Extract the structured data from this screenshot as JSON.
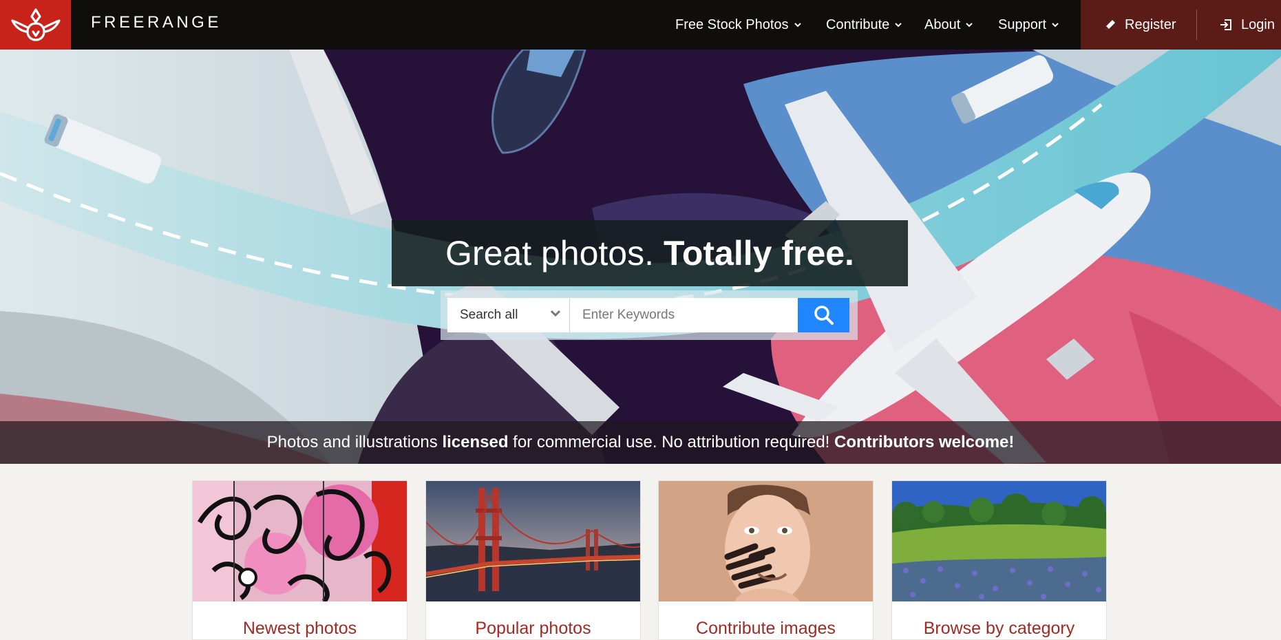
{
  "brand": {
    "name": "FREERANGE",
    "logo_icon": "lotus-logo-icon",
    "logo_color": "#c8231b"
  },
  "nav": {
    "items": [
      {
        "label": "Free Stock Photos",
        "icon": "chevron-down-icon"
      },
      {
        "label": "Contribute",
        "icon": "chevron-down-icon"
      },
      {
        "label": "About",
        "icon": "chevron-down-icon"
      },
      {
        "label": "Support",
        "icon": "chevron-down-icon"
      }
    ],
    "register": {
      "label": "Register",
      "icon": "pencil-icon"
    },
    "login": {
      "label": "Login",
      "icon": "login-icon"
    }
  },
  "hero": {
    "headline_regular": "Great photos.",
    "headline_bold": "Totally free.",
    "search": {
      "scope_selected": "Search all",
      "placeholder": "Enter Keywords",
      "button_icon": "search-icon",
      "button_color": "#1f86ff"
    },
    "tagline": {
      "part1": "Photos and illustrations ",
      "part2_bold": "licensed",
      "part3": " for commercial use. No attribution required! ",
      "part4_bold": "Contributors welcome!"
    }
  },
  "cards": [
    {
      "title": "Newest photos",
      "image": "graffiti-photo"
    },
    {
      "title": "Popular photos",
      "image": "golden-gate-bridge-photo"
    },
    {
      "title": "Contribute images",
      "image": "painted-face-portrait-photo"
    },
    {
      "title": "Browse by category",
      "image": "wildflower-meadow-photo"
    }
  ],
  "colors": {
    "accent_red": "#a32a24",
    "header_bg": "#0f0e0c",
    "account_bg": "#5b1c17"
  }
}
